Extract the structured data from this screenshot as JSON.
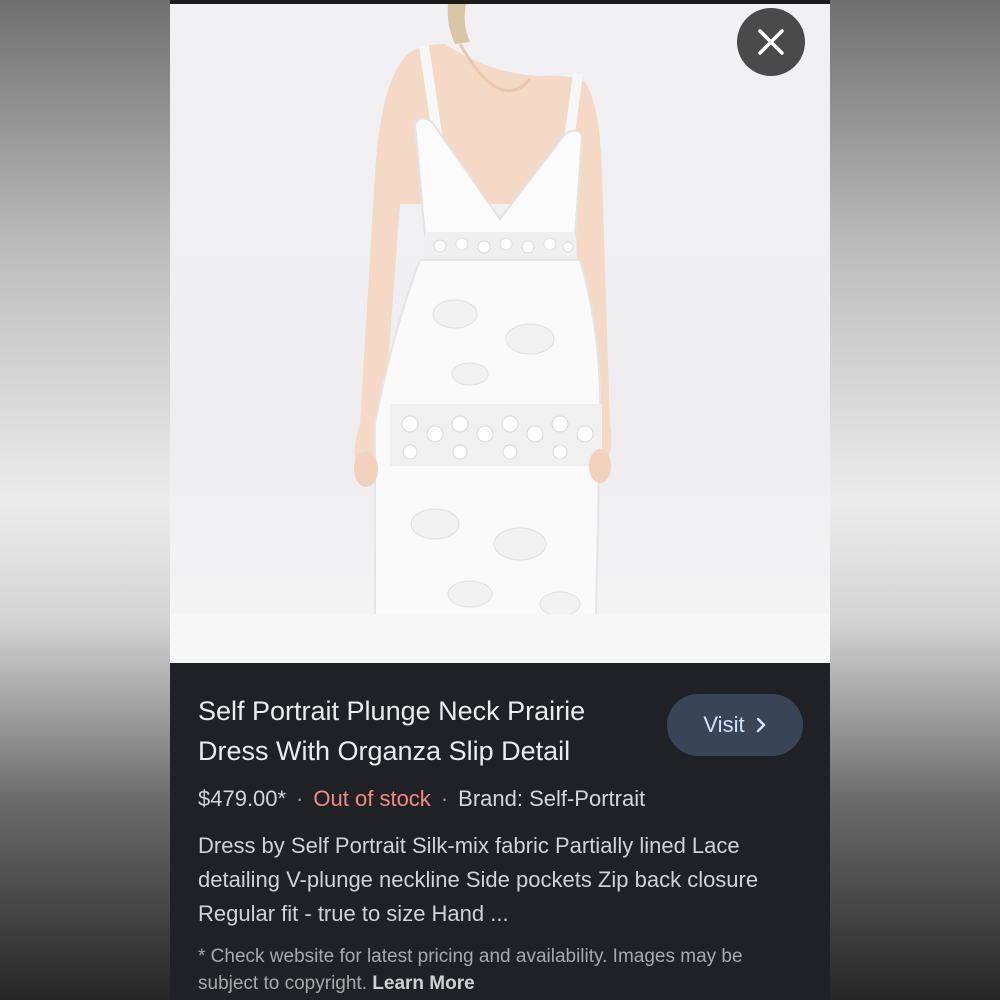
{
  "product": {
    "title": "Self Portrait Plunge Neck Prairie Dress With Organza Slip Detail",
    "price": "$479.00*",
    "separator": "·",
    "stock_status": "Out of stock",
    "brand": "Brand: Self-Portrait",
    "description": "Dress by Self Portrait Silk-mix fabric Partially lined Lace detailing V-plunge neckline Side pockets Zip back closure Regular fit - true to size Hand ..."
  },
  "actions": {
    "visit_label": "Visit",
    "visit_icon": "chevron-right-icon",
    "close_icon": "close-icon"
  },
  "disclaimer": {
    "text": "* Check website for latest pricing and availability. Images may be subject to copyright.",
    "link": "Learn More"
  },
  "colors": {
    "panel_bg": "#202124",
    "visit_bg": "#394457",
    "visit_text": "#d2e3fc",
    "stock_text": "#f28b82"
  }
}
